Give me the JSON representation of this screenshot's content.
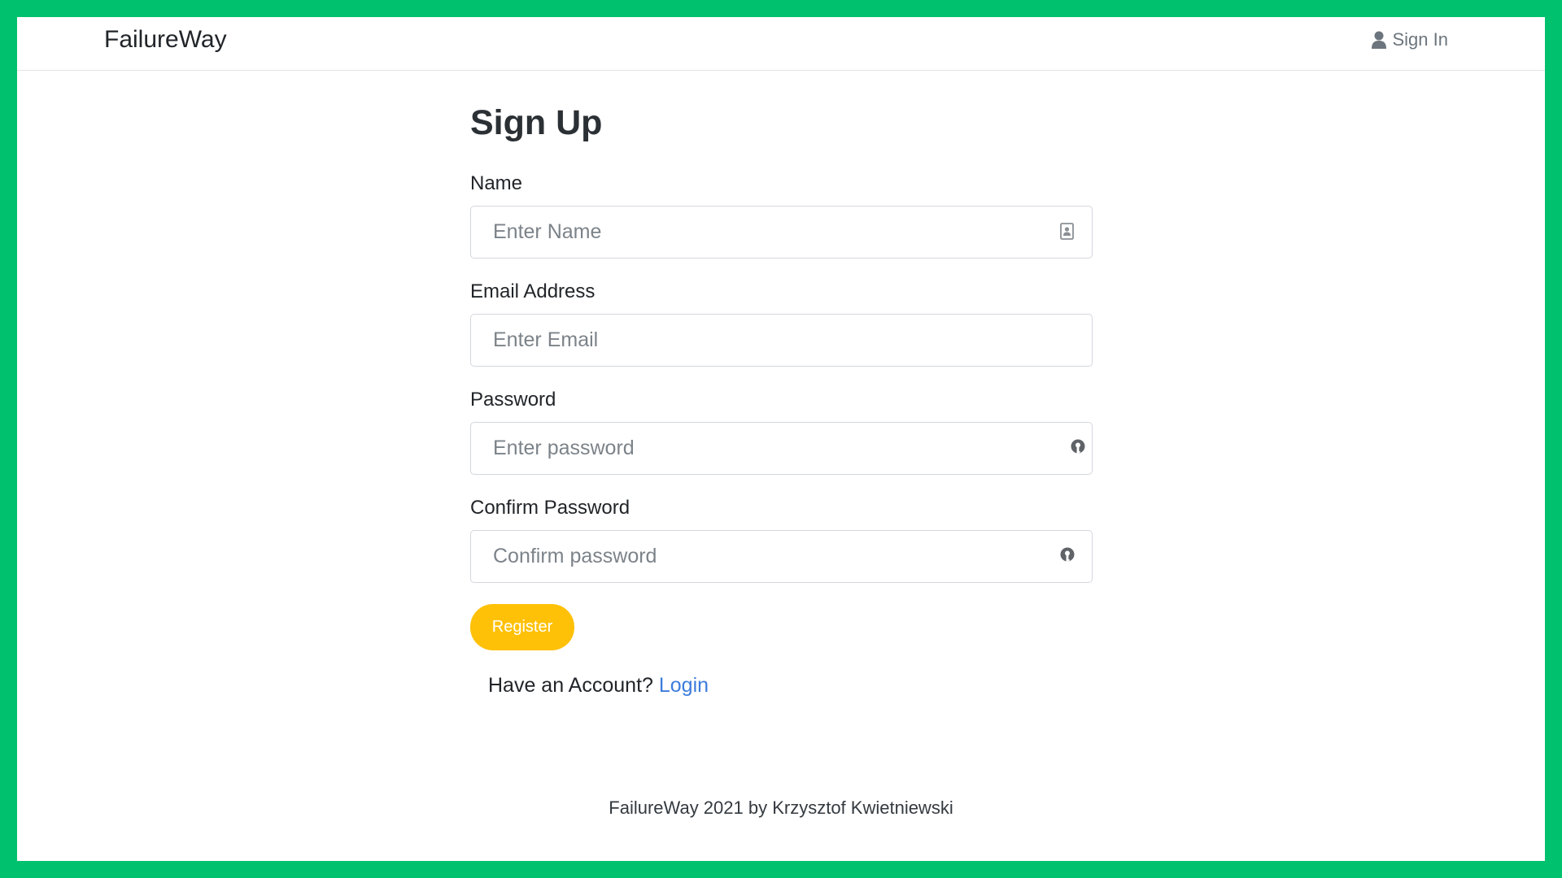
{
  "navbar": {
    "brand": "FailureWay",
    "signin_label": "Sign In",
    "signin_icon": "user-icon"
  },
  "form": {
    "title": "Sign Up",
    "fields": [
      {
        "label": "Name",
        "placeholder": "Enter Name",
        "value": "",
        "icon": "contact-card-icon"
      },
      {
        "label": "Email Address",
        "placeholder": "Enter Email",
        "value": ""
      },
      {
        "label": "Password",
        "placeholder": "Enter password",
        "value": "",
        "icon": "password-key-icon"
      },
      {
        "label": "Confirm Password",
        "placeholder": "Confirm password",
        "value": "",
        "icon": "password-key-icon"
      }
    ],
    "register_label": "Register",
    "account_prompt": "Have an Account?",
    "login_label": "Login"
  },
  "footer": {
    "text": "FailureWay 2021 by Krzysztof Kwietniewski"
  },
  "colors": {
    "frame_border": "#00c16e",
    "register_button": "#ffc107",
    "link": "#3d7bdc"
  }
}
